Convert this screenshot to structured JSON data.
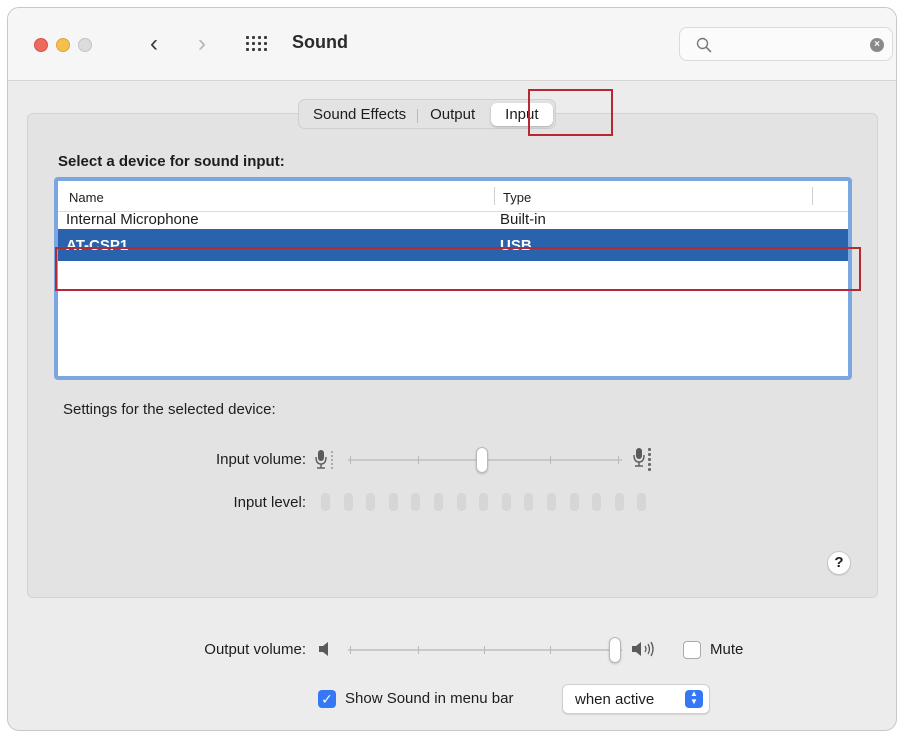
{
  "window": {
    "title": "Sound"
  },
  "search": {
    "value": "",
    "placeholder": ""
  },
  "tabs": [
    {
      "label": "Sound Effects",
      "selected": false
    },
    {
      "label": "Output",
      "selected": false
    },
    {
      "label": "Input",
      "selected": true
    }
  ],
  "input": {
    "section_label": "Select a device for sound input:",
    "columns": [
      "Name",
      "Type"
    ],
    "devices": [
      {
        "name": "Internal Microphone",
        "type": "Built-in",
        "selected": false
      },
      {
        "name": "AT-CSP1",
        "type": "USB",
        "selected": true
      }
    ],
    "settings_label": "Settings for the selected device:",
    "input_volume_label": "Input volume:",
    "input_volume": 0.5,
    "input_level_label": "Input level:",
    "input_level_segments": 15,
    "input_level_active": 0
  },
  "output_volume": {
    "label": "Output volume:",
    "value": 1.0,
    "mute_label": "Mute",
    "mute_checked": false
  },
  "menu_bar": {
    "label": "Show Sound in menu bar",
    "checked": true,
    "popup_value": "when active"
  },
  "colors": {
    "selection": "#2963ad",
    "focus_ring": "#7aa7e0",
    "checkbox_accent": "#3478f6",
    "highlight_box": "#b52a32"
  },
  "icons": {
    "back": "chevron-left",
    "forward": "chevron-right",
    "all_prefs": "grid",
    "search": "magnifying-glass",
    "clear": "x-circle",
    "help": "question-mark"
  }
}
